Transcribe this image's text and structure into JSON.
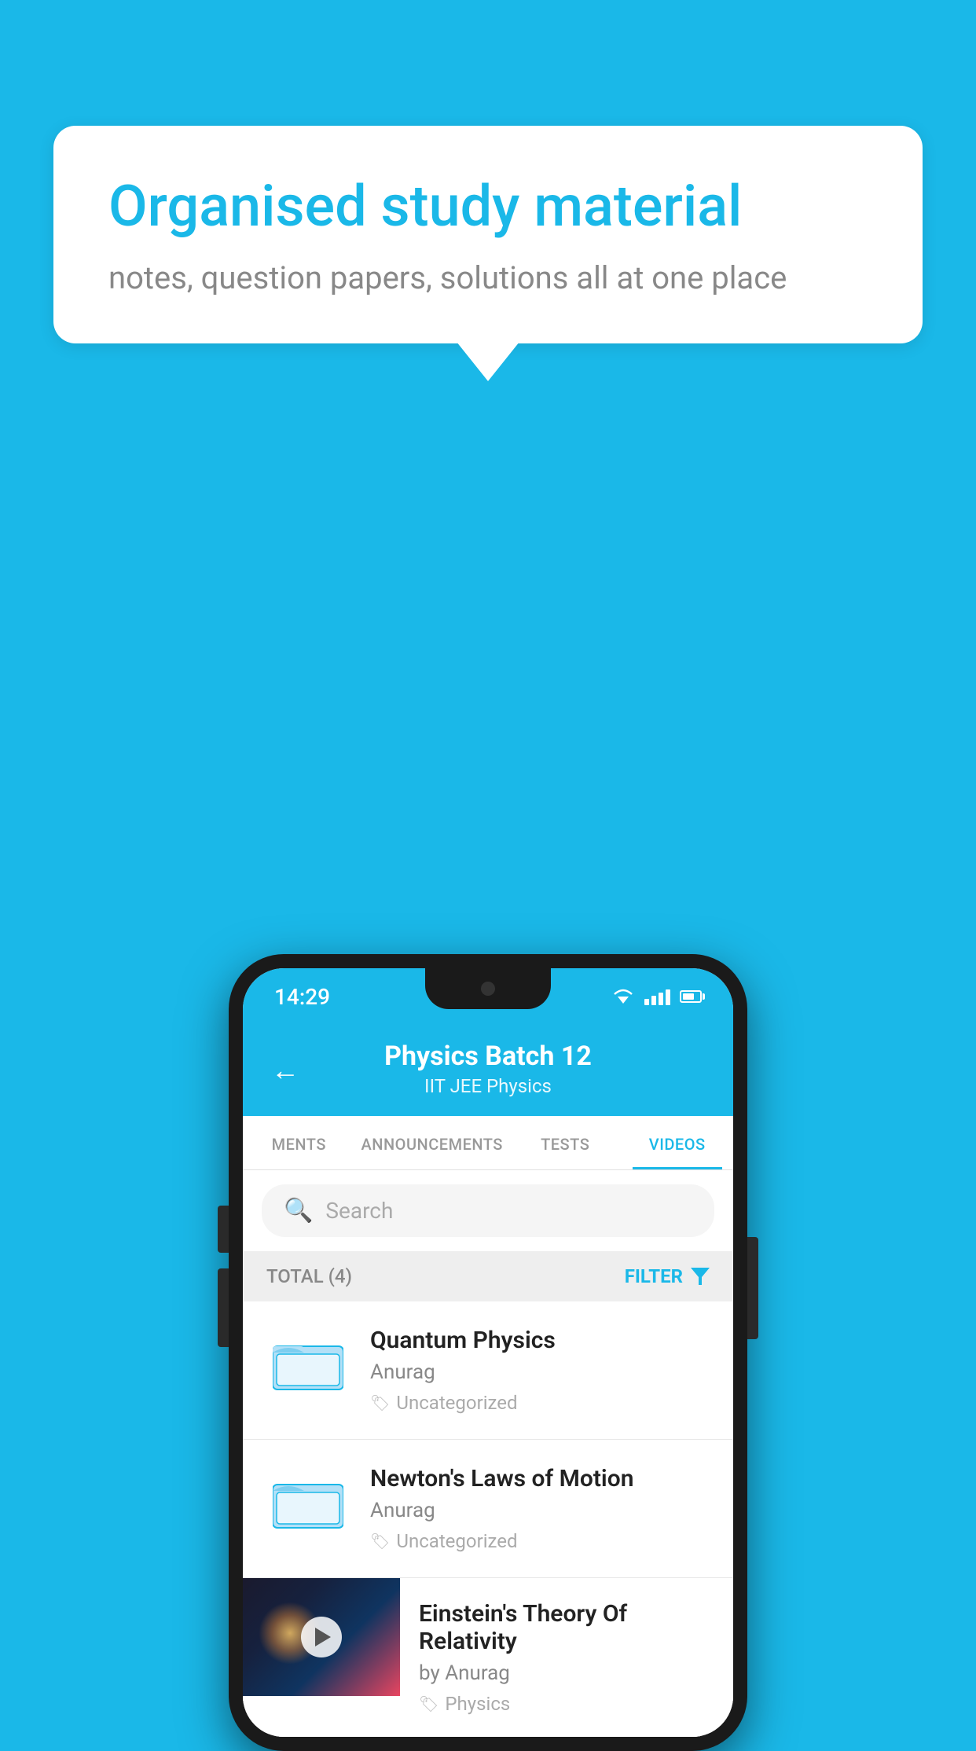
{
  "bubble": {
    "title": "Organised study material",
    "subtitle": "notes, question papers, solutions all at one place"
  },
  "status_bar": {
    "time": "14:29"
  },
  "app_bar": {
    "title": "Physics Batch 12",
    "subtitle": "IIT JEE    Physics",
    "back_label": "←"
  },
  "tabs": [
    {
      "label": "MENTS",
      "active": false
    },
    {
      "label": "ANNOUNCEMENTS",
      "active": false
    },
    {
      "label": "TESTS",
      "active": false
    },
    {
      "label": "VIDEOS",
      "active": true
    }
  ],
  "search": {
    "placeholder": "Search"
  },
  "filter_bar": {
    "total_label": "TOTAL (4)",
    "filter_label": "FILTER"
  },
  "videos": [
    {
      "title": "Quantum Physics",
      "author": "Anurag",
      "tag": "Uncategorized",
      "has_thumb": false
    },
    {
      "title": "Newton's Laws of Motion",
      "author": "Anurag",
      "tag": "Uncategorized",
      "has_thumb": false
    },
    {
      "title": "Einstein's Theory Of Relativity",
      "author": "by Anurag",
      "tag": "Physics",
      "has_thumb": true
    }
  ]
}
